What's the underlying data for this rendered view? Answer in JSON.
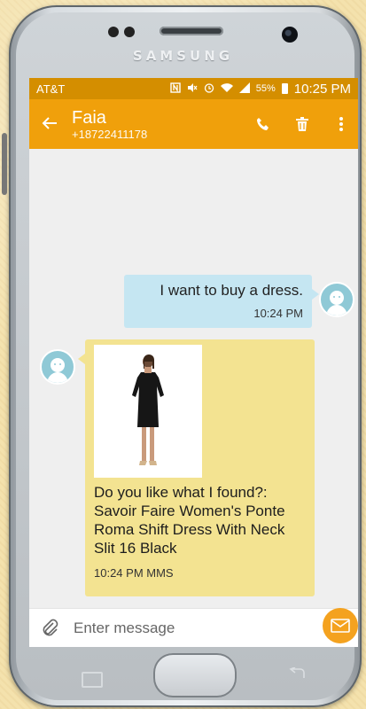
{
  "phone": {
    "brand": "SAMSUNG"
  },
  "status_bar": {
    "carrier": "AT&T",
    "battery": "55%",
    "time": "10:25 PM"
  },
  "app_bar": {
    "name": "Faia",
    "number": "+18722411178"
  },
  "messages": [
    {
      "direction": "outgoing",
      "text": "I want to buy a dress.",
      "time": "10:24 PM"
    },
    {
      "direction": "incoming",
      "text": "Do you like what I found?: Savoir Faire Women's Ponte Roma Shift Dress With Neck Slit 16 Black",
      "time": "10:24 PM MMS"
    }
  ],
  "composer": {
    "placeholder": "Enter message"
  },
  "colors": {
    "status_bar": "#d48e00",
    "app_bar": "#f0a00b",
    "outgoing_bubble": "#c5e6f2",
    "incoming_bubble": "#f3e391",
    "send_button": "#f4a21f"
  }
}
